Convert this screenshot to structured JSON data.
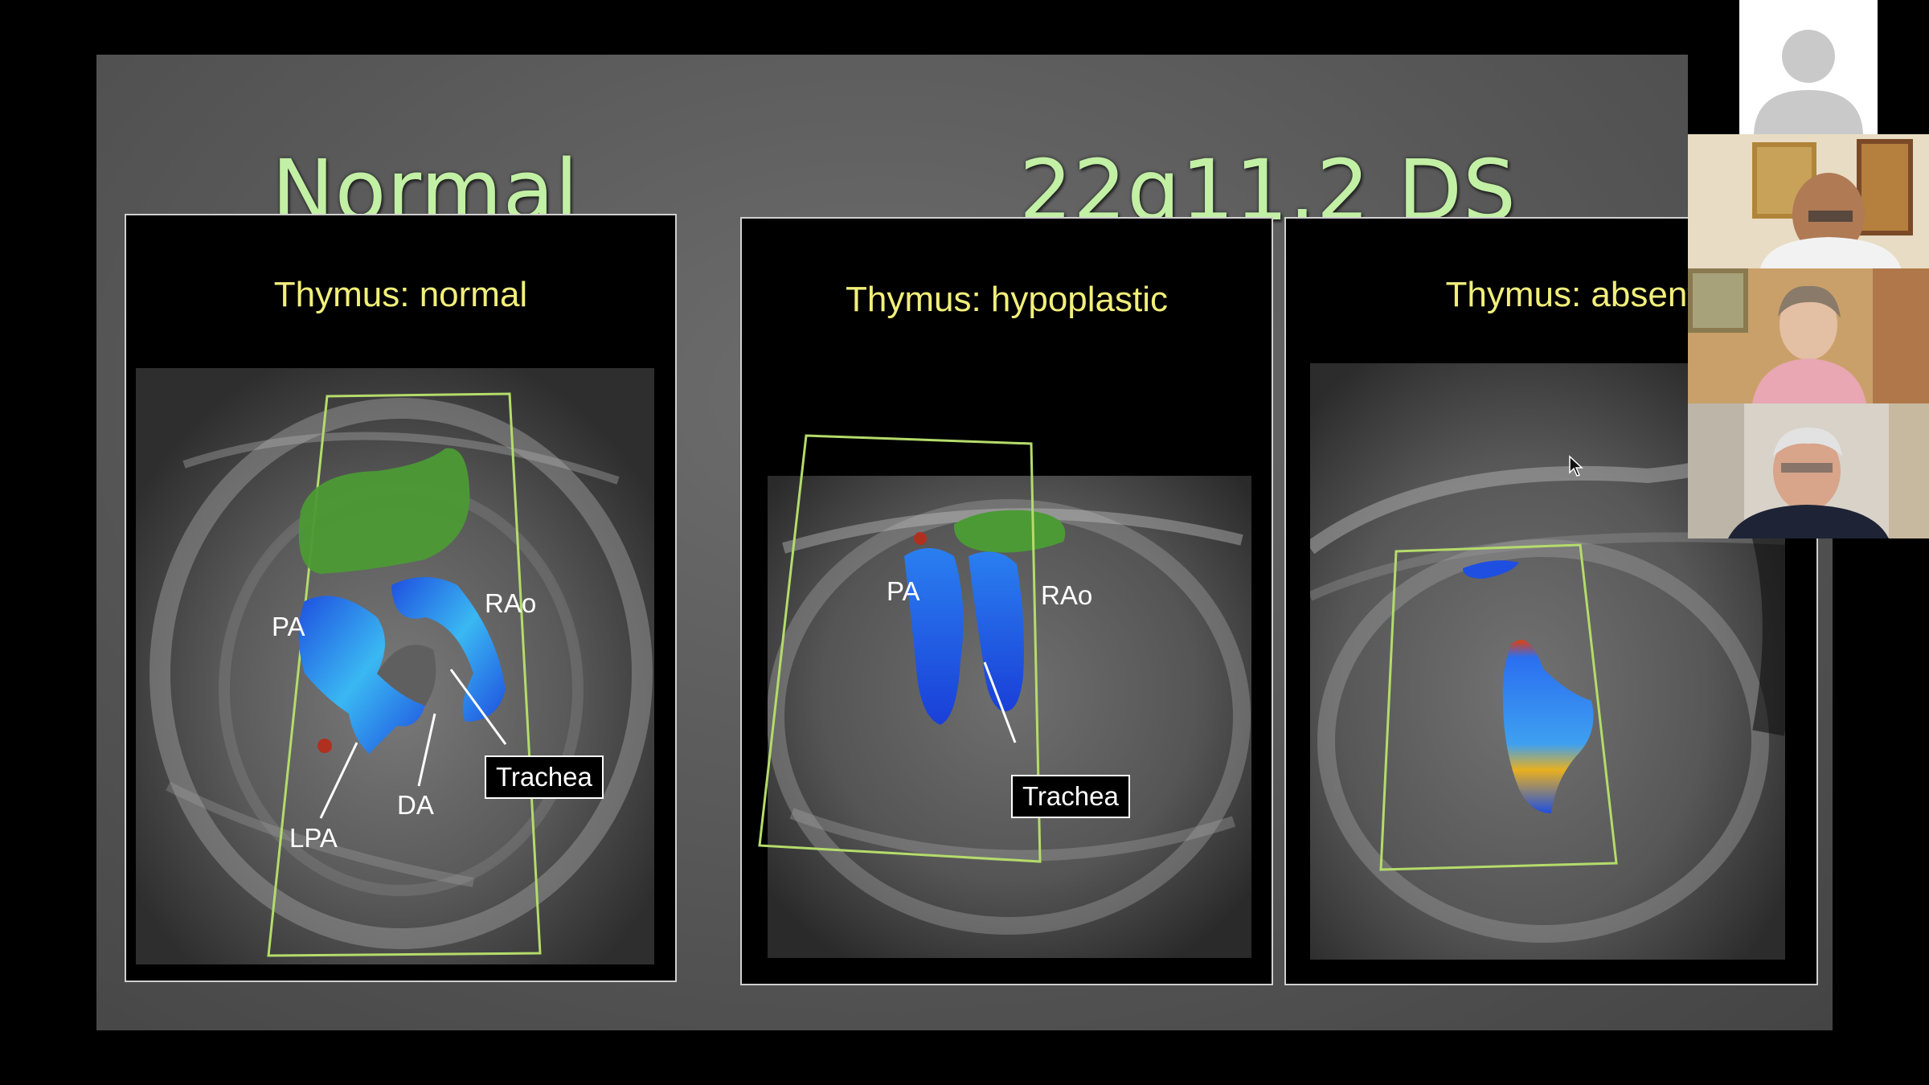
{
  "slide": {
    "heading_left": "Normal",
    "heading_right": "22q11.2 DS",
    "heading_color": "#c2f0a4",
    "panels": [
      {
        "title": "Thymus: normal",
        "labels": {
          "pa": "PA",
          "rao": "RAo",
          "trachea": "Trachea",
          "da": "DA",
          "lpa": "LPA"
        }
      },
      {
        "title": "Thymus: hypoplastic",
        "labels": {
          "pa": "PA",
          "rao": "RAo",
          "trachea": "Trachea"
        }
      },
      {
        "title": "Thymus: absent"
      }
    ]
  },
  "colors": {
    "title_yellow": "#f2ef7a",
    "thymus_green": "#4c9a35",
    "doppler_blue": "#1f5ae0",
    "roi_outline": "#b4dc6a"
  },
  "video_tiles": [
    {
      "kind": "avatar-placeholder",
      "icon": "person-silhouette-icon"
    },
    {
      "kind": "participant-video"
    },
    {
      "kind": "participant-video"
    },
    {
      "kind": "participant-video"
    }
  ]
}
